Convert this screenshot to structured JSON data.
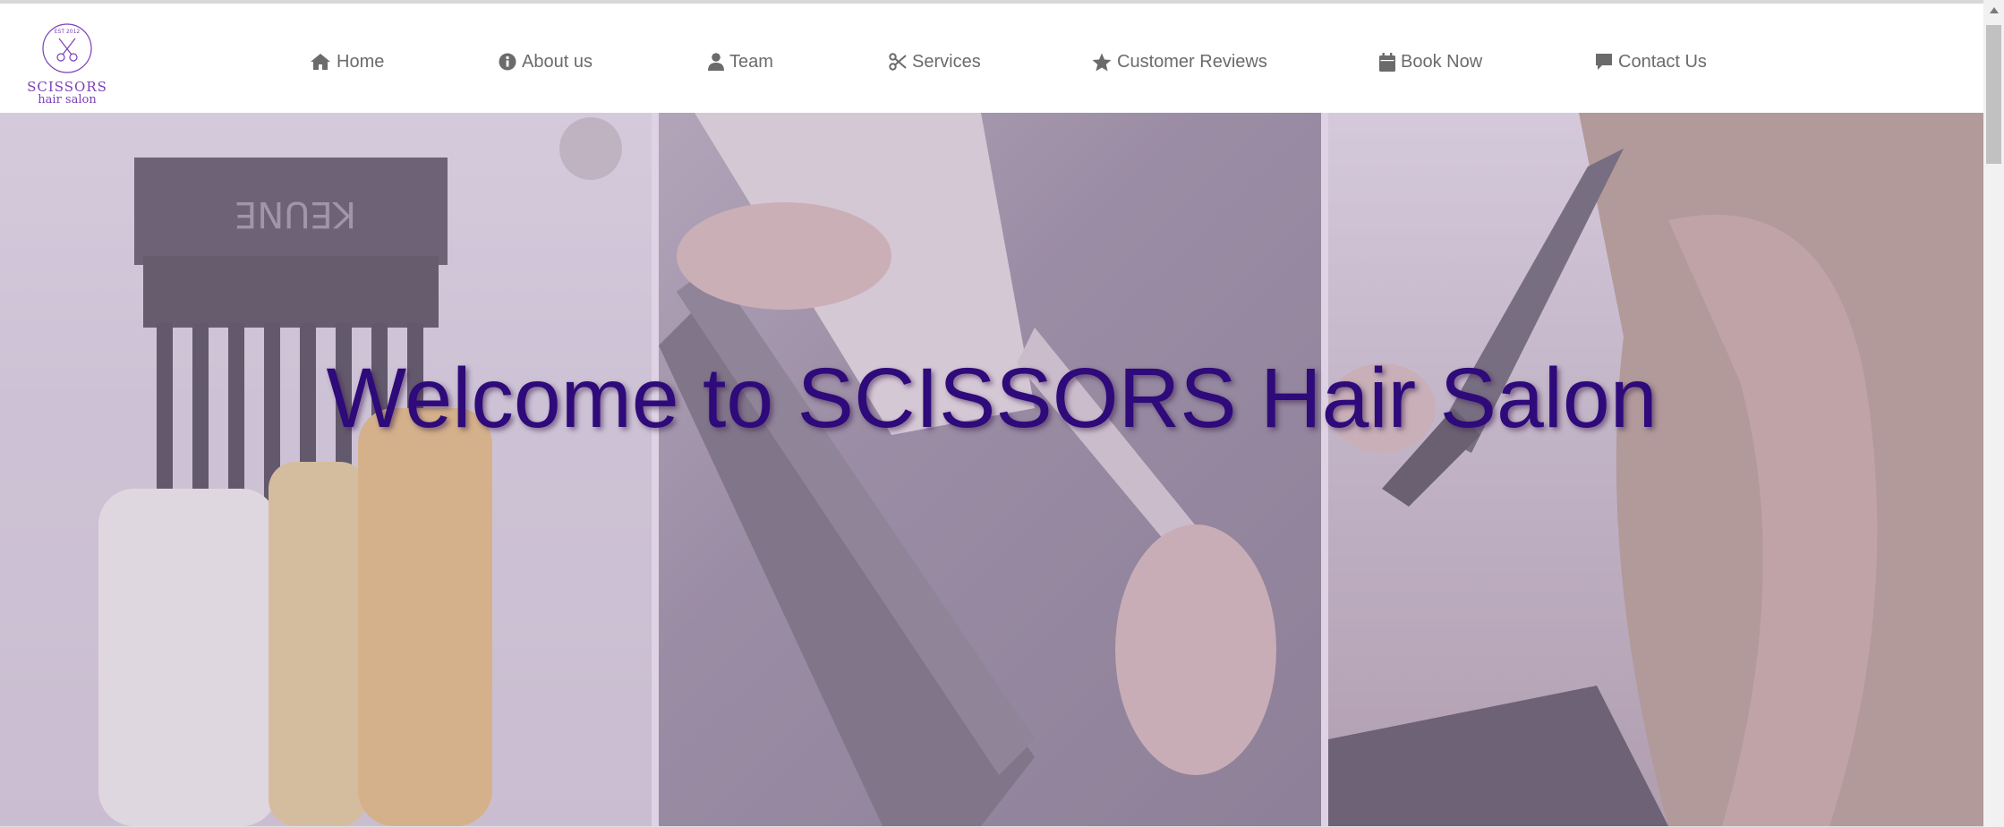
{
  "logo": {
    "established": "EST 2012",
    "name": "SCISSORS",
    "subtitle": "hair salon"
  },
  "nav": [
    {
      "label": "Home",
      "icon": "home-icon"
    },
    {
      "label": "About us",
      "icon": "info-icon"
    },
    {
      "label": "Team",
      "icon": "user-icon"
    },
    {
      "label": "Services",
      "icon": "scissors-icon"
    },
    {
      "label": "Customer Reviews",
      "icon": "star-icon"
    },
    {
      "label": "Book Now",
      "icon": "calendar-icon"
    },
    {
      "label": "Contact Us",
      "icon": "comment-icon"
    }
  ],
  "hero": {
    "title": "Welcome to SCISSORS Hair Salon",
    "brush_brand": "KEUNE"
  },
  "colors": {
    "accent": "#7b3fb8",
    "title": "#2e0a7a",
    "nav_text": "#6b6b6b"
  }
}
